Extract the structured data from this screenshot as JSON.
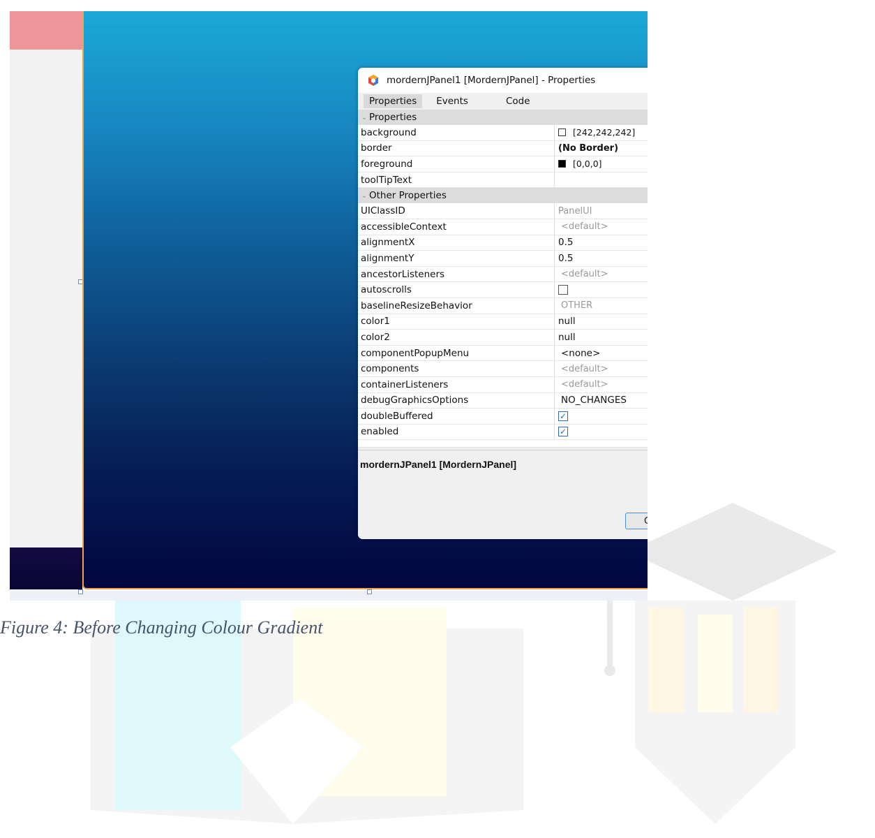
{
  "dialog": {
    "title": "mordernJPanel1 [MordernJPanel] - Properties",
    "tabs": [
      "Properties",
      "Events",
      "Code"
    ],
    "categories": {
      "properties": "Properties",
      "other": "Other Properties"
    },
    "properties": [
      {
        "name": "background",
        "value": "[242,242,242]",
        "swatch": "white"
      },
      {
        "name": "border",
        "value": "(No Border)",
        "style": "bold"
      },
      {
        "name": "foreground",
        "value": "[0,0,0]",
        "swatch": "black"
      },
      {
        "name": "toolTipText",
        "value": ""
      }
    ],
    "other_properties": [
      {
        "name": "UIClassID",
        "value": "PanelUI",
        "style": "gray"
      },
      {
        "name": "accessibleContext",
        "value": "<default>",
        "style": "gray-ind"
      },
      {
        "name": "alignmentX",
        "value": "0.5"
      },
      {
        "name": "alignmentY",
        "value": "0.5"
      },
      {
        "name": "ancestorListeners",
        "value": "<default>",
        "style": "gray-ind"
      },
      {
        "name": "autoscrolls",
        "checkbox": false
      },
      {
        "name": "baselineResizeBehavior",
        "value": "OTHER",
        "style": "gray-ind"
      },
      {
        "name": "color1",
        "value": "null"
      },
      {
        "name": "color2",
        "value": "null"
      },
      {
        "name": "componentPopupMenu",
        "value": "<none>",
        "style": "ind"
      },
      {
        "name": "components",
        "value": "<default>",
        "style": "gray-ind"
      },
      {
        "name": "containerListeners",
        "value": "<default>",
        "style": "gray-ind"
      },
      {
        "name": "debugGraphicsOptions",
        "value": "NO_CHANGES",
        "style": "ind"
      },
      {
        "name": "doubleBuffered",
        "checkbox": true
      },
      {
        "name": "enabled",
        "checkbox": true
      }
    ],
    "description_title": "mordernJPanel1 [MordernJPanel]",
    "close_button_label": "C"
  },
  "caption": "Figure 4: Before Changing Colour Gradient",
  "colors": {
    "gradient_top": "#1ba9d9",
    "gradient_bottom": "#02053f",
    "selection_border": "#f2a34a",
    "left_header": "#ee9599"
  }
}
